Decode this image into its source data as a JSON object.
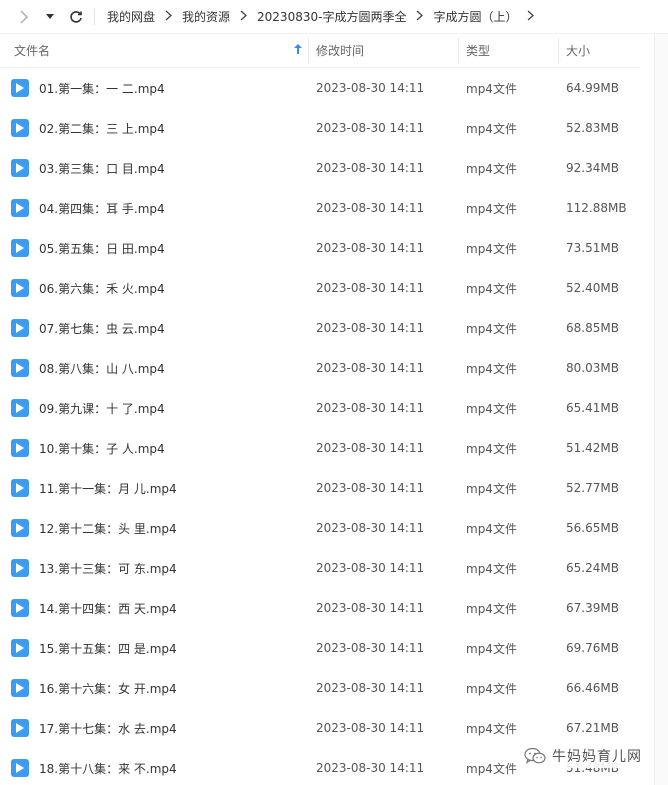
{
  "nav": {
    "breadcrumbs": [
      "我的网盘",
      "我的资源",
      "20230830-字成方圆两季全",
      "字成方圆（上）"
    ]
  },
  "columns": {
    "name": "文件名",
    "mtime": "修改时间",
    "type": "类型",
    "size": "大小"
  },
  "files": [
    {
      "name": "01.第一集：一 二.mp4",
      "mtime": "2023-08-30 14:11",
      "type": "mp4文件",
      "size": "64.99MB"
    },
    {
      "name": "02.第二集：三 上.mp4",
      "mtime": "2023-08-30 14:11",
      "type": "mp4文件",
      "size": "52.83MB"
    },
    {
      "name": "03.第三集：口 目.mp4",
      "mtime": "2023-08-30 14:11",
      "type": "mp4文件",
      "size": "92.34MB"
    },
    {
      "name": "04.第四集：耳 手.mp4",
      "mtime": "2023-08-30 14:11",
      "type": "mp4文件",
      "size": "112.88MB"
    },
    {
      "name": "05.第五集：日 田.mp4",
      "mtime": "2023-08-30 14:11",
      "type": "mp4文件",
      "size": "73.51MB"
    },
    {
      "name": "06.第六集：禾 火.mp4",
      "mtime": "2023-08-30 14:11",
      "type": "mp4文件",
      "size": "52.40MB"
    },
    {
      "name": "07.第七集：虫 云.mp4",
      "mtime": "2023-08-30 14:11",
      "type": "mp4文件",
      "size": "68.85MB"
    },
    {
      "name": "08.第八集：山 八.mp4",
      "mtime": "2023-08-30 14:11",
      "type": "mp4文件",
      "size": "80.03MB"
    },
    {
      "name": "09.第九课：十 了.mp4",
      "mtime": "2023-08-30 14:11",
      "type": "mp4文件",
      "size": "65.41MB"
    },
    {
      "name": "10.第十集：子 人.mp4",
      "mtime": "2023-08-30 14:11",
      "type": "mp4文件",
      "size": "51.42MB"
    },
    {
      "name": "11.第十一集：月 儿.mp4",
      "mtime": "2023-08-30 14:11",
      "type": "mp4文件",
      "size": "52.77MB"
    },
    {
      "name": "12.第十二集：头 里.mp4",
      "mtime": "2023-08-30 14:11",
      "type": "mp4文件",
      "size": "56.65MB"
    },
    {
      "name": "13.第十三集：可 东.mp4",
      "mtime": "2023-08-30 14:11",
      "type": "mp4文件",
      "size": "65.24MB"
    },
    {
      "name": "14.第十四集：西 天.mp4",
      "mtime": "2023-08-30 14:11",
      "type": "mp4文件",
      "size": "67.39MB"
    },
    {
      "name": "15.第十五集：四 是.mp4",
      "mtime": "2023-08-30 14:11",
      "type": "mp4文件",
      "size": "69.76MB"
    },
    {
      "name": "16.第十六集：女 开.mp4",
      "mtime": "2023-08-30 14:11",
      "type": "mp4文件",
      "size": "66.46MB"
    },
    {
      "name": "17.第十七集：水 去.mp4",
      "mtime": "2023-08-30 14:11",
      "type": "mp4文件",
      "size": "67.21MB"
    },
    {
      "name": "18.第十八集：来 不.mp4",
      "mtime": "2023-08-30 14:11",
      "type": "mp4文件",
      "size": "51.48MB"
    }
  ],
  "watermark": "牛妈妈育儿网",
  "colors": {
    "file_icon": "#3d9bf0",
    "sort_arrow": "#3a8ee6"
  }
}
